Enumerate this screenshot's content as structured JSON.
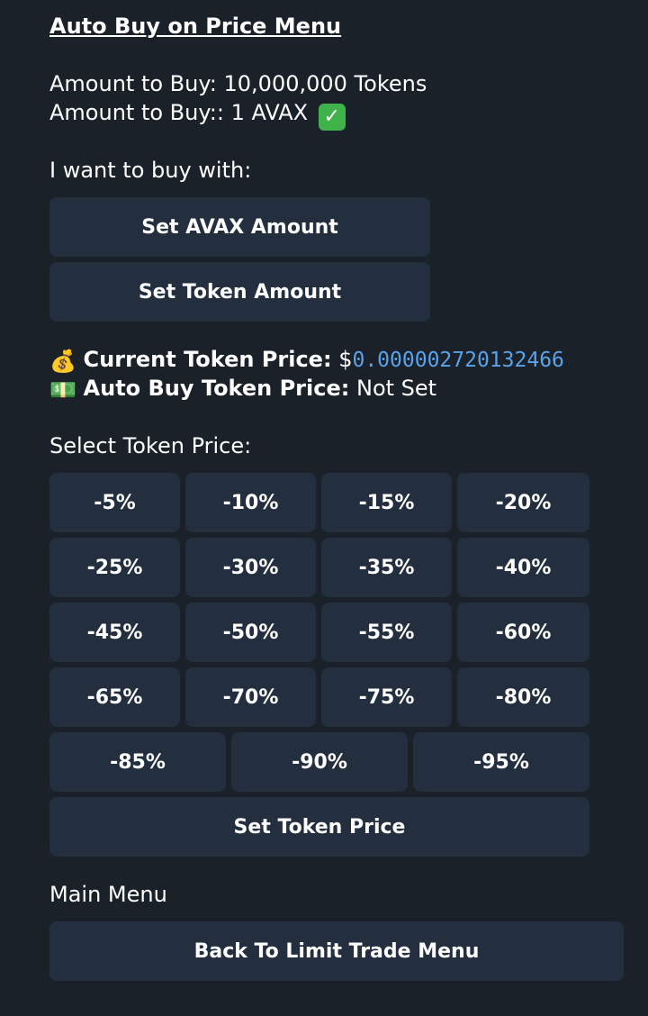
{
  "message": {
    "title": "Auto Buy on Price Menu",
    "amount_tokens": "Amount to Buy: 10,000,000 Tokens",
    "amount_avax": "Amount to Buy:: 1 AVAX",
    "amount_avax_check": "✓",
    "buy_with": "I want to buy with:",
    "current_price_emoji": "💰",
    "current_price_label": "Current Token Price:",
    "current_price_currency": "$",
    "current_price_value": "0.000002720132466",
    "auto_price_emoji": "💵",
    "auto_price_label": "Auto Buy Token Price:",
    "auto_price_value": "Not Set",
    "select_price": "Select Token Price:",
    "main_menu": "Main Menu"
  },
  "buttons": {
    "set_avax": "Set AVAX Amount",
    "set_token": "Set Token Amount",
    "pct": [
      "-5%",
      "-10%",
      "-15%",
      "-20%",
      "-25%",
      "-30%",
      "-35%",
      "-40%",
      "-45%",
      "-50%",
      "-55%",
      "-60%",
      "-65%",
      "-70%",
      "-75%",
      "-80%",
      "-85%",
      "-90%",
      "-95%"
    ],
    "set_price": "Set Token Price",
    "back": "Back To Limit Trade Menu"
  },
  "colors": {
    "background": "#1b2129",
    "button": "#232e3e",
    "price_link": "#5aa2ea",
    "check": "#3fb24a"
  }
}
